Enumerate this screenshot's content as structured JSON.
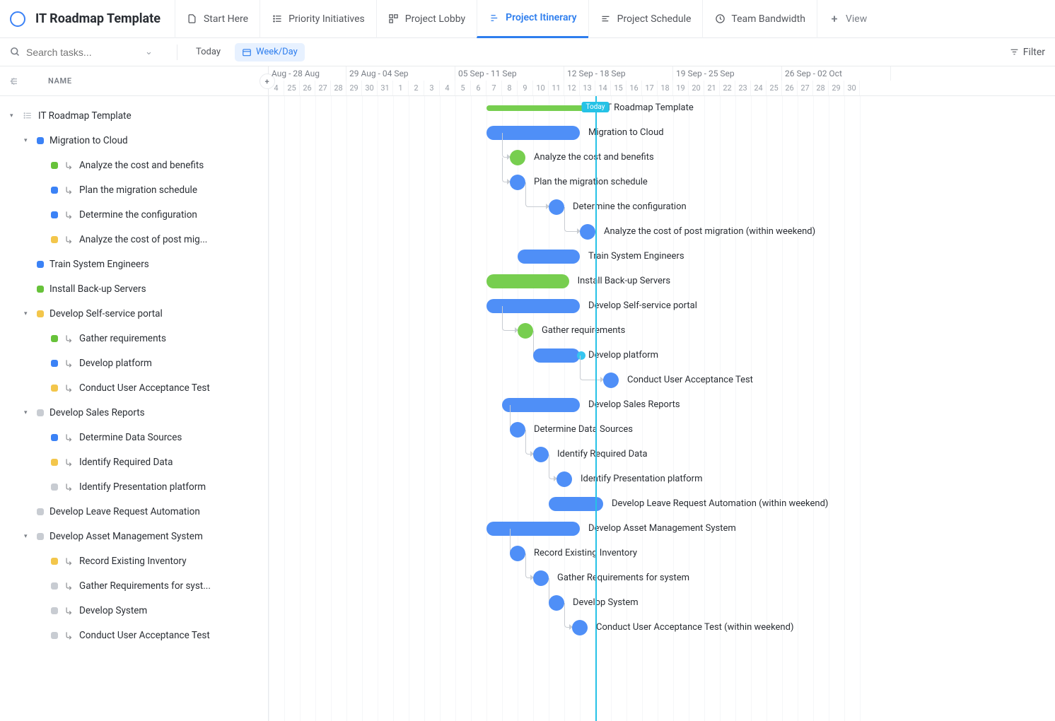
{
  "header": {
    "title": "IT Roadmap Template",
    "views": [
      {
        "label": "Start Here"
      },
      {
        "label": "Priority Initiatives"
      },
      {
        "label": "Project Lobby"
      },
      {
        "label": "Project Itinerary",
        "active": true
      },
      {
        "label": "Project Schedule"
      },
      {
        "label": "Team Bandwidth"
      },
      {
        "label": "View",
        "add": true
      }
    ]
  },
  "toolbar": {
    "search_placeholder": "Search tasks...",
    "today_label": "Today",
    "range_label": "Week/Day",
    "filter_label": "Filter"
  },
  "left": {
    "column_label": "NAME"
  },
  "timeline": {
    "day_width": 22,
    "first_day": 4,
    "today_col": 21,
    "today_label": "Today",
    "ranges": [
      {
        "label": "Aug - 28 Aug",
        "days": 5
      },
      {
        "label": "29 Aug - 04 Sep",
        "days": 7
      },
      {
        "label": "05 Sep - 11 Sep",
        "days": 7
      },
      {
        "label": "12 Sep - 18 Sep",
        "days": 7
      },
      {
        "label": "19 Sep - 25 Sep",
        "days": 7
      },
      {
        "label": "26 Sep - 02 Oct",
        "days": 7
      }
    ],
    "days": [
      "4",
      "25",
      "26",
      "27",
      "28",
      "29",
      "30",
      "31",
      "1",
      "2",
      "3",
      "4",
      "5",
      "6",
      "7",
      "8",
      "9",
      "10",
      "11",
      "12",
      "13",
      "14",
      "15",
      "16",
      "17",
      "18",
      "19",
      "20",
      "21",
      "22",
      "23",
      "24",
      "25",
      "26",
      "27",
      "28",
      "29",
      "30"
    ]
  },
  "tasks": [
    {
      "depth": 0,
      "type": "list",
      "caret": true,
      "label": "IT Roadmap Template",
      "bar": {
        "shape": "thin",
        "color": "green",
        "start": 14,
        "span": 7
      }
    },
    {
      "depth": 1,
      "type": "group",
      "caret": true,
      "dot": "blue",
      "label": "Migration to Cloud",
      "bar": {
        "shape": "bar",
        "color": "blue",
        "start": 14,
        "span": 6
      }
    },
    {
      "depth": 2,
      "type": "sub",
      "dot": "green",
      "label": "Analyze the cost and benefits",
      "bar": {
        "shape": "bubble",
        "color": "green",
        "start": 15.5
      },
      "conn": {
        "from": 15,
        "drop": 1
      }
    },
    {
      "depth": 2,
      "type": "sub",
      "dot": "blue",
      "label": "Plan the migration schedule",
      "bar": {
        "shape": "bubble",
        "color": "blue",
        "start": 15.5
      },
      "conn": {
        "from": 15,
        "drop": 1
      }
    },
    {
      "depth": 2,
      "type": "sub",
      "dot": "blue",
      "label": "Determine the configuration",
      "bar": {
        "shape": "bubble",
        "color": "blue",
        "start": 18
      },
      "conn": {
        "from": 16.5,
        "drop": 1
      }
    },
    {
      "depth": 2,
      "type": "sub",
      "dot": "yellow",
      "label": "Analyze the cost of post mig...",
      "full": "Analyze the cost of post migration (within weekend)",
      "bar": {
        "shape": "bubble",
        "color": "blue",
        "start": 20
      },
      "conn": {
        "from": 19,
        "drop": 1
      }
    },
    {
      "depth": 1,
      "type": "task",
      "dot": "blue",
      "label": "Train System Engineers",
      "bar": {
        "shape": "bar",
        "color": "blue",
        "start": 16,
        "span": 4
      }
    },
    {
      "depth": 1,
      "type": "task",
      "dot": "green",
      "label": "Install Back-up Servers",
      "bar": {
        "shape": "bar",
        "color": "green",
        "start": 14,
        "span": 5.3
      }
    },
    {
      "depth": 1,
      "type": "group",
      "caret": true,
      "dot": "yellow",
      "label": "Develop Self-service portal",
      "bar": {
        "shape": "bar",
        "color": "blue",
        "start": 14,
        "span": 6
      }
    },
    {
      "depth": 2,
      "type": "sub",
      "dot": "green",
      "label": "Gather requirements",
      "bar": {
        "shape": "bubble",
        "color": "green",
        "start": 16
      },
      "conn": {
        "from": 15,
        "drop": 1
      }
    },
    {
      "depth": 2,
      "type": "sub",
      "dot": "blue",
      "label": "Develop platform",
      "bar": {
        "shape": "bar",
        "color": "blue",
        "start": 17,
        "span": 3,
        "trail": "cyan"
      },
      "conn": {
        "from": 17,
        "drop": 1
      }
    },
    {
      "depth": 2,
      "type": "sub",
      "dot": "yellow",
      "label": "Conduct User Acceptance Test",
      "bar": {
        "shape": "bubble",
        "color": "blue",
        "start": 21.5
      },
      "conn": {
        "from": 20,
        "drop": 1
      }
    },
    {
      "depth": 1,
      "type": "group",
      "caret": true,
      "dot": "grey",
      "label": "Develop Sales Reports",
      "bar": {
        "shape": "bar",
        "color": "blue",
        "start": 15,
        "span": 5
      }
    },
    {
      "depth": 2,
      "type": "sub",
      "dot": "blue",
      "label": "Determine Data Sources",
      "bar": {
        "shape": "bubble",
        "color": "blue",
        "start": 15.5
      },
      "conn": {
        "from": 15.5,
        "drop": 1
      }
    },
    {
      "depth": 2,
      "type": "sub",
      "dot": "yellow",
      "label": "Identify Required Data",
      "bar": {
        "shape": "bubble",
        "color": "blue",
        "start": 17
      },
      "conn": {
        "from": 16.5,
        "drop": 1
      }
    },
    {
      "depth": 2,
      "type": "sub",
      "dot": "grey",
      "label": "Identify Presentation platform",
      "bar": {
        "shape": "bubble",
        "color": "blue",
        "start": 18.5
      },
      "conn": {
        "from": 18,
        "drop": 1
      }
    },
    {
      "depth": 1,
      "type": "task",
      "dot": "grey",
      "label": "Develop Leave Request Automation",
      "full": "Develop Leave Request Automation (within weekend)",
      "bar": {
        "shape": "bar",
        "color": "blue",
        "start": 18,
        "span": 3.5
      }
    },
    {
      "depth": 1,
      "type": "group",
      "caret": true,
      "dot": "grey",
      "label": "Develop Asset Management System",
      "bar": {
        "shape": "bar",
        "color": "blue",
        "start": 14,
        "span": 6
      }
    },
    {
      "depth": 2,
      "type": "sub",
      "dot": "yellow",
      "label": "Record Existing Inventory",
      "bar": {
        "shape": "bubble",
        "color": "blue",
        "start": 15.5
      },
      "conn": {
        "from": 15.5,
        "drop": 1
      }
    },
    {
      "depth": 2,
      "type": "sub",
      "dot": "grey",
      "label": "Gather Requirements for syst...",
      "full": "Gather Requirements for system",
      "bar": {
        "shape": "bubble",
        "color": "blue",
        "start": 17
      },
      "conn": {
        "from": 16.5,
        "drop": 1
      }
    },
    {
      "depth": 2,
      "type": "sub",
      "dot": "grey",
      "label": "Develop System",
      "bar": {
        "shape": "bubble",
        "color": "blue",
        "start": 18
      },
      "conn": {
        "from": 18,
        "drop": 1
      }
    },
    {
      "depth": 2,
      "type": "sub",
      "dot": "grey",
      "label": "Conduct User Acceptance Test",
      "full": "Conduct User Acceptance Test (within weekend)",
      "bar": {
        "shape": "bubble",
        "color": "blue",
        "start": 19.5
      },
      "conn": {
        "from": 19,
        "drop": 1
      }
    }
  ]
}
